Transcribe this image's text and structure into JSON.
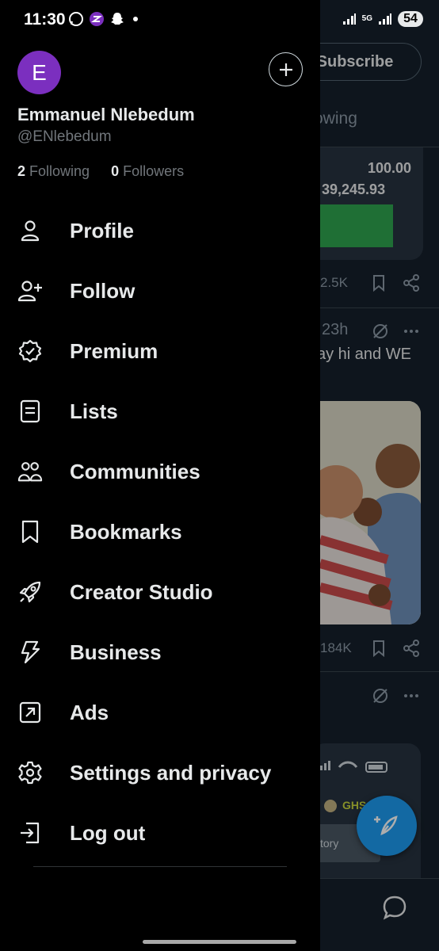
{
  "status_bar": {
    "time": "11:30",
    "network": "5G",
    "battery": "54",
    "left_icons": [
      "whatsapp-icon",
      "app-icon",
      "snapchat-icon",
      "notification-dot"
    ]
  },
  "drawer": {
    "avatar_letter": "E",
    "display_name": "Emmanuel Nlebedum",
    "handle": "@ENlebedum",
    "following_count": "2",
    "following_label": "Following",
    "followers_count": "0",
    "followers_label": "Followers",
    "menu": [
      {
        "label": "Profile",
        "icon": "person-icon"
      },
      {
        "label": "Follow",
        "icon": "person-add-icon"
      },
      {
        "label": "Premium",
        "icon": "verified-badge-icon"
      },
      {
        "label": "Lists",
        "icon": "list-icon"
      },
      {
        "label": "Communities",
        "icon": "communities-icon"
      },
      {
        "label": "Bookmarks",
        "icon": "bookmark-icon"
      },
      {
        "label": "Creator Studio",
        "icon": "rocket-icon"
      },
      {
        "label": "Business",
        "icon": "lightning-icon"
      },
      {
        "label": "Ads",
        "icon": "ads-arrow-icon"
      },
      {
        "label": "Settings and privacy",
        "icon": "gear-icon"
      },
      {
        "label": "Log out",
        "icon": "logout-icon"
      }
    ]
  },
  "feed": {
    "subscribe_label": "Subscribe",
    "tab_partial": "owing",
    "card_value_1": "100.00",
    "card_value_2": "39,245.93",
    "metric_1": "2.5K",
    "post_time": "23h",
    "post_text": "ay hi and WE",
    "metric_2": "184K",
    "ghs_label": "GHS",
    "story_label": "tory"
  },
  "colors": {
    "accent": "#1d9bf0",
    "avatar": "#7b2fbf",
    "drawer_bg": "#000000",
    "feed_bg": "#15202b"
  }
}
